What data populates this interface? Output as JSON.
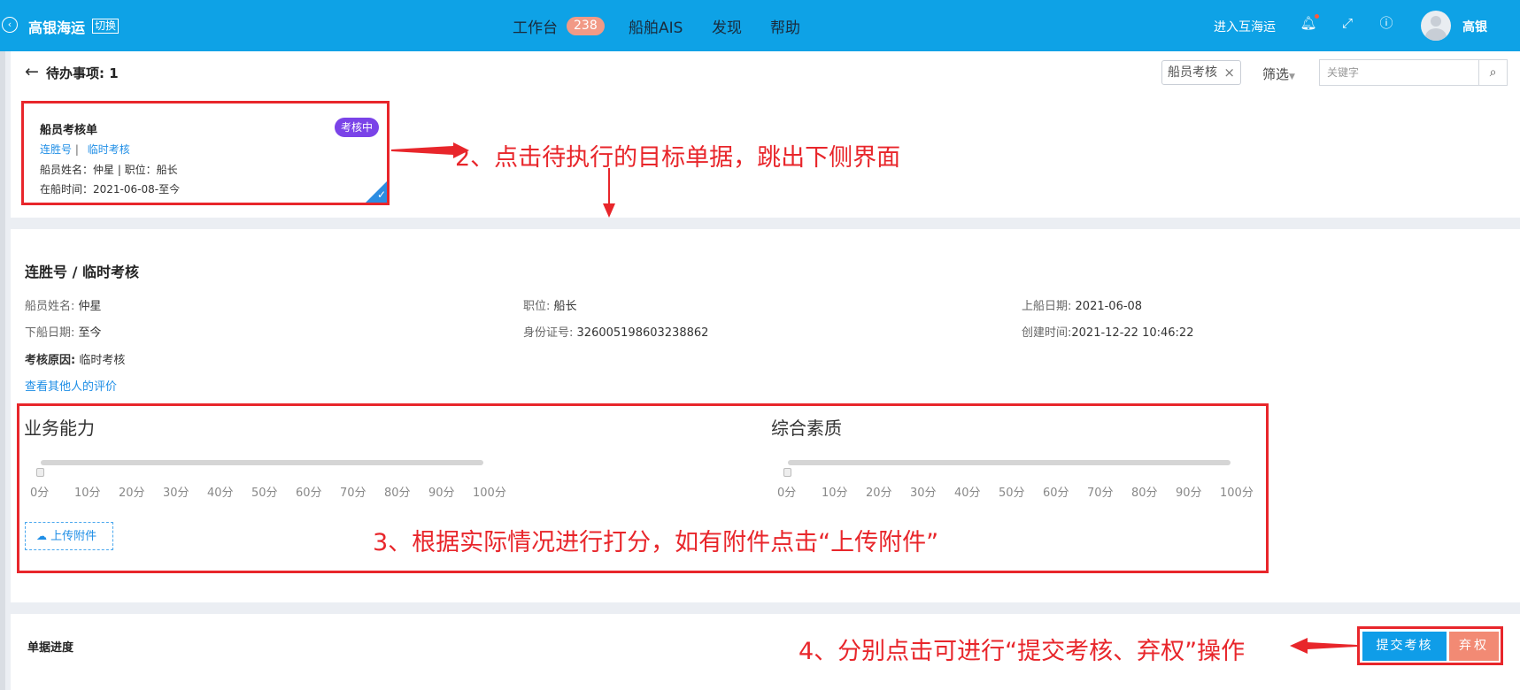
{
  "header": {
    "brand": "高银海运",
    "switch_label": "切换",
    "nav": [
      {
        "label": "工作台",
        "badge": "238"
      },
      {
        "label": "船舶AIS"
      },
      {
        "label": "发现"
      },
      {
        "label": "帮助"
      }
    ],
    "enter_link": "进入互海运",
    "username": "高银"
  },
  "todo": {
    "title": "待办事项: 1",
    "filter_tag": "船员考核",
    "filter_label": "筛选",
    "search_placeholder": "关键字"
  },
  "card": {
    "title": "船员考核单",
    "status": "考核中",
    "link_ship": "连胜号",
    "separator": "|",
    "link_type": "临时考核",
    "line2": "船员姓名：仲星 | 职位：船长",
    "line3": "在船时间：2021-06-08-至今"
  },
  "annotations": {
    "a2": "2、点击待执行的目标单据，跳出下侧界面",
    "a3": "3、根据实际情况进行打分，如有附件点击“上传附件”",
    "a4": "4、分别点击可进行“提交考核、弃权”操作"
  },
  "detail": {
    "title": "连胜号 / 临时考核",
    "name_label": "船员姓名:",
    "name_value": "仲星",
    "position_label": "职位:",
    "position_value": "船长",
    "board_label": "上船日期:",
    "board_value": "2021-06-08",
    "leave_label": "下船日期:",
    "leave_value": "至今",
    "id_label": "身份证号:",
    "id_value": "326005198603238862",
    "created_label": "创建时间:",
    "created_value": "2021-12-22 10:46:22",
    "reason_label": "考核原因:",
    "reason_value": "临时考核",
    "view_others": "查看其他人的评价"
  },
  "scores": [
    {
      "title": "业务能力",
      "value": 0,
      "ticks": [
        "0分",
        "10分",
        "20分",
        "30分",
        "40分",
        "50分",
        "60分",
        "70分",
        "80分",
        "90分",
        "100分"
      ]
    },
    {
      "title": "综合素质",
      "value": 0,
      "ticks": [
        "0分",
        "10分",
        "20分",
        "30分",
        "40分",
        "50分",
        "60分",
        "70分",
        "80分",
        "90分",
        "100分"
      ]
    }
  ],
  "upload_label": "上传附件",
  "progress_title": "单据进度",
  "actions": {
    "submit": "提交考核",
    "abandon": "弃权"
  },
  "colors": {
    "primary": "#0ea2e6",
    "annotation": "#e8262b",
    "status_pill": "#7a43e8",
    "abandon": "#f28a74"
  }
}
